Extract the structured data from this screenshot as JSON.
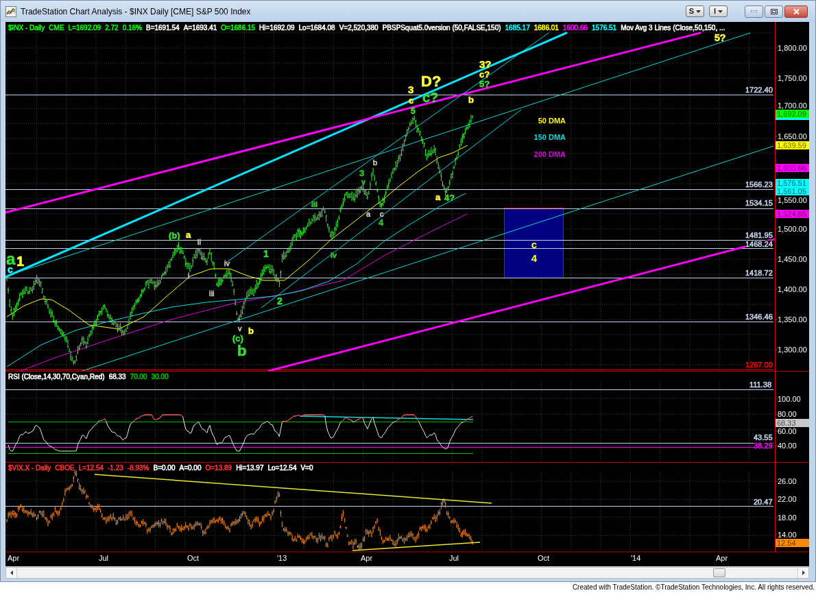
{
  "window": {
    "title": "TradeStation Chart Analysis - $INX Daily [CME] S&P 500 Index"
  },
  "title_buttons": [
    {
      "label": "S"
    },
    {
      "label": "I"
    }
  ],
  "price_panel": {
    "header": [
      {
        "text": "$INX - Daily",
        "color": "#00ff00"
      },
      {
        "text": "CME",
        "color": "#00ff00"
      },
      {
        "text": "L=1692.09",
        "color": "#00ff00"
      },
      {
        "text": "2.72",
        "color": "#00ff00"
      },
      {
        "text": "0.16%",
        "color": "#00ff00"
      },
      {
        "text": "B=1691.54",
        "color": "#ffffff"
      },
      {
        "text": "A=1693.41",
        "color": "#ffffff"
      },
      {
        "text": "O=1686.15",
        "color": "#00ff00"
      },
      {
        "text": "Hi=1692.09",
        "color": "#ffffff"
      },
      {
        "text": "Lo=1684.08",
        "color": "#ffffff"
      },
      {
        "text": "V=2,520,380",
        "color": "#ffffff"
      },
      {
        "text": "PBSPSquat5.0version (50,FALSE,150)",
        "color": "#ffffff"
      },
      {
        "text": "1685.17",
        "color": "#00ffff"
      },
      {
        "text": "1686.01",
        "color": "#ffff00"
      },
      {
        "text": "1600.66",
        "color": "#ff00ff"
      },
      {
        "text": "1576.51",
        "color": "#00ffff"
      },
      {
        "text": "Mov Avg 3 Lines (Close,50,150, ...",
        "color": "#ffffff"
      }
    ],
    "axis_labels": [
      "1,800.00",
      "1,750.00",
      "1,700.00",
      "1,650.00",
      "1,550.00",
      "1,500.00",
      "1,450.00",
      "1,400.00",
      "1,350.00",
      "1,300.00"
    ],
    "price_tags": [
      {
        "text": "1,692.09",
        "color": "#00ff00"
      },
      {
        "text": "1,639.59",
        "color": "#ffff00"
      },
      {
        "text": "1,600.66",
        "color": "#ff00ff"
      },
      {
        "text": "1,576.51",
        "color": "#00ffff"
      },
      {
        "text": "1,561.05",
        "color": "#00ffff"
      },
      {
        "text": "1,524.85",
        "color": "#ff00ff"
      }
    ],
    "covered_tag": {
      "color": "#00ffff"
    },
    "levels": [
      {
        "label": "1722.40",
        "color": "#c0d0e8"
      },
      {
        "label": "1566.23",
        "color": "#c0d0e8"
      },
      {
        "label": "1534.15",
        "color": "#c0d0e8"
      },
      {
        "label": "1481.95",
        "color": "#c0d0e8"
      },
      {
        "label": "1468.24",
        "color": "#c0d0e8"
      },
      {
        "label": "1418.72",
        "color": "#c0d0e8"
      },
      {
        "label": "1346.46",
        "color": "#c0d0e8"
      },
      {
        "label": "1267.00",
        "color": "#ff0000"
      }
    ],
    "wave_labels": [
      {
        "text": "a",
        "color": "#33dd33"
      },
      {
        "text": "1",
        "color": "#ffff33"
      },
      {
        "text": "c",
        "color": "#33ffff"
      },
      {
        "text": "(b)",
        "color": "#33dd33"
      },
      {
        "text": "a",
        "color": "#ffff33"
      },
      {
        "text": "ii",
        "color": "#d0d0d0"
      },
      {
        "text": "i",
        "color": "#d0d0d0"
      },
      {
        "text": "iv",
        "color": "#d0d0d0"
      },
      {
        "text": "iii",
        "color": "#d0d0d0"
      },
      {
        "text": "v",
        "color": "#d0d0d0"
      },
      {
        "text": "b",
        "color": "#ffff33"
      },
      {
        "text": "(c)",
        "color": "#33dd33"
      },
      {
        "text": "b",
        "color": "#33dd33"
      },
      {
        "text": "1",
        "color": "#33dd33"
      },
      {
        "text": "2",
        "color": "#33dd33"
      },
      {
        "text": "iii",
        "color": "#33bb33"
      },
      {
        "text": "iv",
        "color": "#33bb33"
      },
      {
        "text": "3",
        "color": "#33bb33"
      },
      {
        "text": "v",
        "color": "#33bb33"
      },
      {
        "text": "b",
        "color": "#d0d0d0"
      },
      {
        "text": "a",
        "color": "#d0d0d0"
      },
      {
        "text": "c",
        "color": "#d0d0d0"
      },
      {
        "text": "4",
        "color": "#33bb33"
      },
      {
        "text": "3",
        "color": "#ffff33"
      },
      {
        "text": "c",
        "color": "#ffff33"
      },
      {
        "text": "5",
        "color": "#33dd33"
      },
      {
        "text": "D?",
        "color": "#ffff33"
      },
      {
        "text": "c?",
        "color": "#33dd33"
      },
      {
        "text": "3?",
        "color": "#ffff33"
      },
      {
        "text": "c?",
        "color": "#ffff33"
      },
      {
        "text": "5?",
        "color": "#33dd33"
      },
      {
        "text": "b",
        "color": "#ffff33"
      },
      {
        "text": "a",
        "color": "#ffff33"
      },
      {
        "text": "4?",
        "color": "#33dd33"
      },
      {
        "text": "5?",
        "color": "#ffff33"
      }
    ],
    "legend": [
      {
        "text": "50 DMA",
        "color": "#ffff00"
      },
      {
        "text": "150 DMA",
        "color": "#00e0e0"
      },
      {
        "text": "200 DMA",
        "color": "#e000e0"
      }
    ],
    "target_box": {
      "labels": [
        "c",
        "4"
      ]
    }
  },
  "rsi_panel": {
    "header": [
      {
        "text": "RSI (Close,14,30,70,Cyan,Red)",
        "color": "#ffffff"
      },
      {
        "text": "68.33",
        "color": "#ffffff"
      },
      {
        "text": "70.00",
        "color": "#00c000"
      },
      {
        "text": "30.00",
        "color": "#00c000"
      }
    ],
    "axis_labels": [
      "100.00",
      "80.00",
      "60.00",
      "40.00"
    ],
    "value_tag": {
      "text": "68.33",
      "color": "#c8c8c8"
    },
    "levels": [
      {
        "label": "111.38",
        "color": "#c0d0e8"
      },
      {
        "label": "43.55",
        "color": "#c0d0e8"
      },
      {
        "label": "38.29",
        "color": "#ff00ff"
      }
    ]
  },
  "vix_panel": {
    "header": [
      {
        "text": "$VIX.X - Daily",
        "color": "#ff3333"
      },
      {
        "text": "CBOE",
        "color": "#ff3333"
      },
      {
        "text": "L=12.54",
        "color": "#ff3333"
      },
      {
        "text": "-1.23",
        "color": "#ff3333"
      },
      {
        "text": "-8.93%",
        "color": "#ff3333"
      },
      {
        "text": "B=0.00",
        "color": "#ffffff"
      },
      {
        "text": "A=0.00",
        "color": "#ffffff"
      },
      {
        "text": "O=13.89",
        "color": "#ff3333"
      },
      {
        "text": "Hi=13.97",
        "color": "#ffffff"
      },
      {
        "text": "Lo=12.54",
        "color": "#ffffff"
      },
      {
        "text": "V=0",
        "color": "#ffffff"
      }
    ],
    "axis_labels": [
      "26.00",
      "22.00",
      "18.00",
      "14.00"
    ],
    "value_tag": {
      "text": "12.54",
      "color": "#ff8c00"
    },
    "levels": [
      {
        "label": "20.47",
        "color": "#c0d0e8"
      }
    ]
  },
  "time_axis": [
    "Apr",
    "Jul",
    "Oct",
    "'13",
    "Apr",
    "Jul",
    "Oct",
    "'14",
    "Apr"
  ],
  "footer": "Created with TradeStation. ©TradeStation Technologies, Inc. All rights reserved."
}
